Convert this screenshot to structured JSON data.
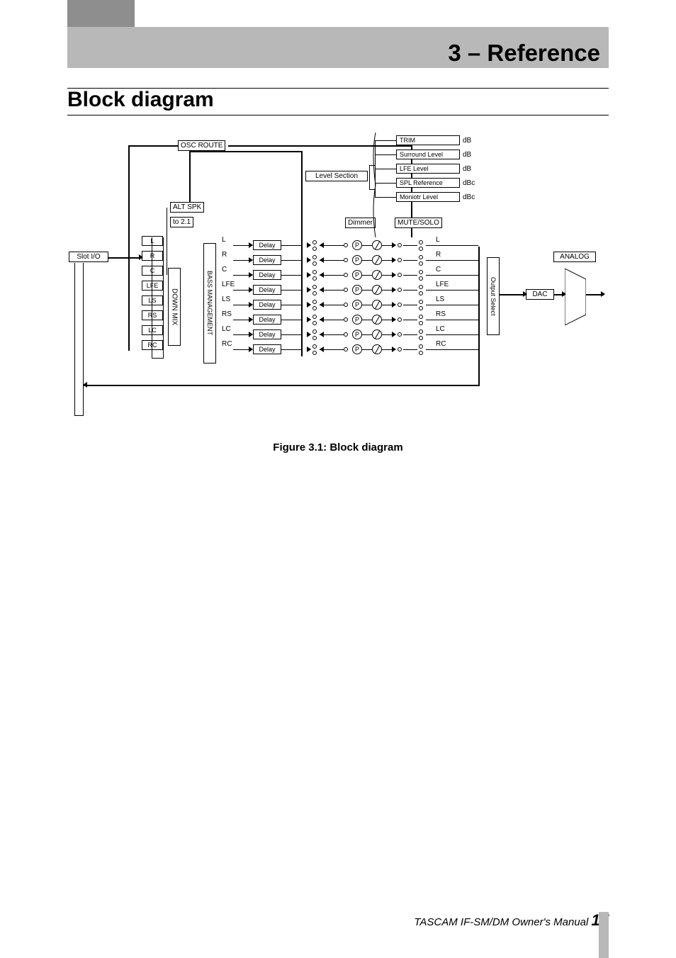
{
  "header": {
    "title": "3 – Reference"
  },
  "section": {
    "title": "Block diagram"
  },
  "caption": "Figure 3.1: Block diagram",
  "footer": {
    "product": "TASCAM IF-SM/DM Owner's Manual",
    "page": "17"
  },
  "diagram": {
    "slot_io": "Slot I/O",
    "osc_route": "OSC ROUTE",
    "alt_spk": "ALT SPK",
    "to_21": "to 2.1",
    "down_mix": "DOWN MIX",
    "bass_mgmt": "BASS MANAGEMENT",
    "level_section": "Level Section",
    "dimmer": "Dimmer",
    "mute_solo": "MUTE/SOLO",
    "output_select": "Output Select",
    "dac": "DAC",
    "analog": "ANALOG",
    "delay": "Delay",
    "p_label": "P",
    "channels_left": [
      "L",
      "R",
      "C",
      "LFE",
      "LS",
      "RS",
      "LC",
      "RC"
    ],
    "channels_mid": [
      "L",
      "R",
      "C",
      "LFE",
      "LS",
      "RS",
      "LC",
      "RC"
    ],
    "channels_right": [
      "L",
      "R",
      "C",
      "LFE",
      "LS",
      "RS",
      "LC",
      "RC"
    ],
    "level_items": [
      {
        "label": "TRIM",
        "unit": "dB"
      },
      {
        "label": "Surround Level",
        "unit": "dB"
      },
      {
        "label": "LFE Level",
        "unit": "dB"
      },
      {
        "label": "SPL Reference",
        "unit": "dBc"
      },
      {
        "label": "Moniotr Level",
        "unit": "dBc"
      }
    ]
  }
}
